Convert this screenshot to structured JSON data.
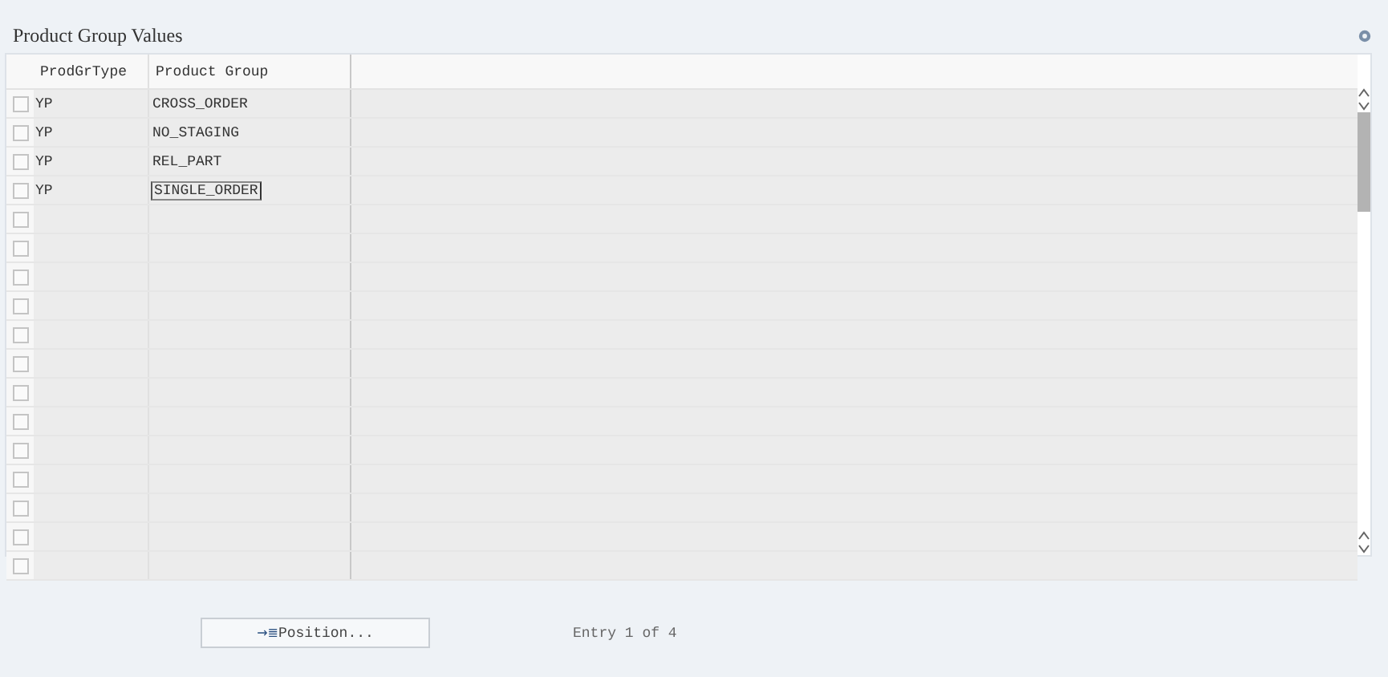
{
  "title": "Product Group Values",
  "table": {
    "columns": [
      "ProdGrType",
      "Product Group"
    ],
    "rows": [
      {
        "selected": false,
        "focused": false,
        "cells": [
          "YP",
          "CROSS_ORDER"
        ]
      },
      {
        "selected": false,
        "focused": false,
        "cells": [
          "YP",
          "NO_STAGING"
        ]
      },
      {
        "selected": false,
        "focused": false,
        "cells": [
          "YP",
          "REL_PART"
        ]
      },
      {
        "selected": false,
        "focused": true,
        "cells": [
          "YP",
          "SINGLE_ORDER"
        ]
      },
      {
        "selected": false,
        "focused": false
      },
      {
        "selected": false,
        "focused": false
      },
      {
        "selected": false,
        "focused": false
      },
      {
        "selected": false,
        "focused": false
      },
      {
        "selected": false,
        "focused": false
      },
      {
        "selected": false,
        "focused": false
      },
      {
        "selected": false,
        "focused": false
      },
      {
        "selected": false,
        "focused": false
      },
      {
        "selected": false,
        "focused": false
      },
      {
        "selected": false,
        "focused": false
      },
      {
        "selected": false,
        "focused": false
      },
      {
        "selected": false,
        "focused": false
      },
      {
        "selected": false,
        "focused": false
      }
    ]
  },
  "position_button": {
    "icon": "→≣",
    "label": "Position..."
  },
  "entry_info": "Entry 1 of 4"
}
